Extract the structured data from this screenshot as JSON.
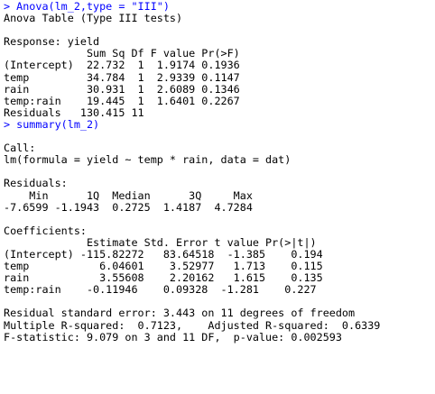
{
  "console": {
    "lines": [
      {
        "type": "cmd",
        "text": "> Anova(lm_2,type = \"III\")"
      },
      {
        "type": "out",
        "text": "Anova Table (Type III tests)"
      },
      {
        "type": "out",
        "text": ""
      },
      {
        "type": "out",
        "text": "Response: yield"
      },
      {
        "type": "out",
        "text": "             Sum Sq Df F value Pr(>F)"
      },
      {
        "type": "out",
        "text": "(Intercept)  22.732  1  1.9174 0.1936"
      },
      {
        "type": "out",
        "text": "temp         34.784  1  2.9339 0.1147"
      },
      {
        "type": "out",
        "text": "rain         30.931  1  2.6089 0.1346"
      },
      {
        "type": "out",
        "text": "temp:rain    19.445  1  1.6401 0.2267"
      },
      {
        "type": "out",
        "text": "Residuals   130.415 11"
      },
      {
        "type": "cmd",
        "text": "> summary(lm_2)"
      },
      {
        "type": "out",
        "text": ""
      },
      {
        "type": "out",
        "text": "Call:"
      },
      {
        "type": "out",
        "text": "lm(formula = yield ~ temp * rain, data = dat)"
      },
      {
        "type": "out",
        "text": ""
      },
      {
        "type": "out",
        "text": "Residuals:"
      },
      {
        "type": "out",
        "text": "    Min      1Q  Median      3Q     Max "
      },
      {
        "type": "out",
        "text": "-7.6599 -1.1943  0.2725  1.4187  4.7284 "
      },
      {
        "type": "out",
        "text": ""
      },
      {
        "type": "out",
        "text": "Coefficients:"
      },
      {
        "type": "out",
        "text": "             Estimate Std. Error t value Pr(>|t|)"
      },
      {
        "type": "out",
        "text": "(Intercept) -115.82272   83.64518  -1.385    0.194"
      },
      {
        "type": "out",
        "text": "temp           6.04601    3.52977   1.713    0.115"
      },
      {
        "type": "out",
        "text": "rain           3.55608    2.20162   1.615    0.135"
      },
      {
        "type": "out",
        "text": "temp:rain    -0.11946    0.09328  -1.281    0.227"
      },
      {
        "type": "out",
        "text": ""
      },
      {
        "type": "out",
        "text": "Residual standard error: 3.443 on 11 degrees of freedom"
      },
      {
        "type": "out",
        "text": "Multiple R-squared:  0.7123,    Adjusted R-squared:  0.6339 "
      },
      {
        "type": "out",
        "text": "F-statistic: 9.079 on 3 and 11 DF,  p-value: 0.002593"
      }
    ]
  },
  "colors": {
    "command": "#0000ff",
    "output": "#000000",
    "background": "#ffffff"
  }
}
